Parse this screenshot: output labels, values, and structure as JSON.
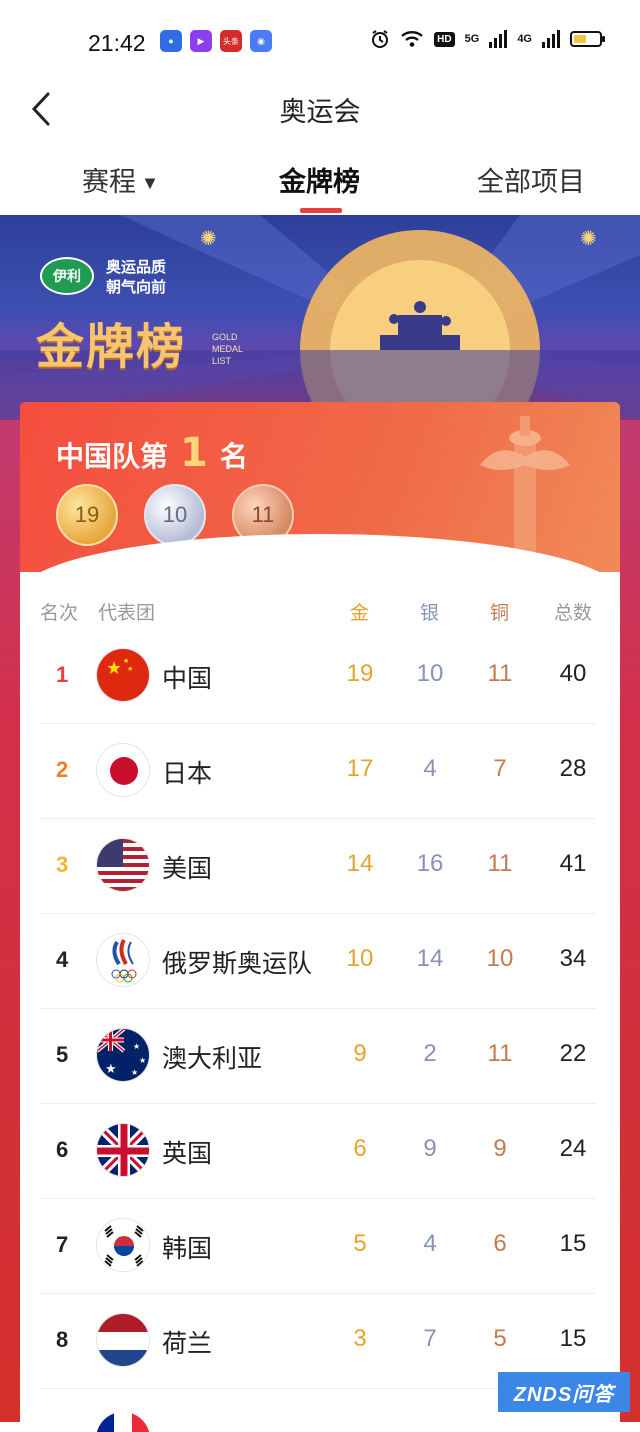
{
  "status_bar": {
    "time": "21:42",
    "hd": "HD",
    "net5g": "5G",
    "net4g": "4G",
    "app_toutiao": "头条"
  },
  "nav": {
    "title": "奥运会"
  },
  "tabs": [
    {
      "label": "赛程",
      "has_dropdown": true
    },
    {
      "label": "金牌榜",
      "active": true
    },
    {
      "label": "全部项目"
    }
  ],
  "banner": {
    "brand": "伊利",
    "slogan_line1": "奥运品质",
    "slogan_line2": "朝气向前",
    "title": "金牌榜",
    "subtitle_line1": "GOLD",
    "subtitle_line2": "MEDAL",
    "subtitle_line3": "LIST"
  },
  "summary": {
    "prefix": "中国队第",
    "rank": "1",
    "suffix": "名",
    "gold": "19",
    "silver": "10",
    "bronze": "11"
  },
  "table": {
    "headers": {
      "rank": "名次",
      "team": "代表团",
      "gold": "金",
      "silver": "银",
      "bronze": "铜",
      "total": "总数"
    },
    "rows": [
      {
        "rank": "1",
        "team": "中国",
        "gold": "19",
        "silver": "10",
        "bronze": "11",
        "total": "40"
      },
      {
        "rank": "2",
        "team": "日本",
        "gold": "17",
        "silver": "4",
        "bronze": "7",
        "total": "28"
      },
      {
        "rank": "3",
        "team": "美国",
        "gold": "14",
        "silver": "16",
        "bronze": "11",
        "total": "41"
      },
      {
        "rank": "4",
        "team": "俄罗斯奥运队",
        "gold": "10",
        "silver": "14",
        "bronze": "10",
        "total": "34"
      },
      {
        "rank": "5",
        "team": "澳大利亚",
        "gold": "9",
        "silver": "2",
        "bronze": "11",
        "total": "22"
      },
      {
        "rank": "6",
        "team": "英国",
        "gold": "6",
        "silver": "9",
        "bronze": "9",
        "total": "24"
      },
      {
        "rank": "7",
        "team": "韩国",
        "gold": "5",
        "silver": "4",
        "bronze": "6",
        "total": "15"
      },
      {
        "rank": "8",
        "team": "荷兰",
        "gold": "3",
        "silver": "7",
        "bronze": "5",
        "total": "15"
      }
    ]
  },
  "watermark": "ZNDS问答",
  "colors": {
    "accent": "#e8403a",
    "gold": "#e2a32f",
    "silver": "#8793b6",
    "bronze": "#c47a52"
  }
}
